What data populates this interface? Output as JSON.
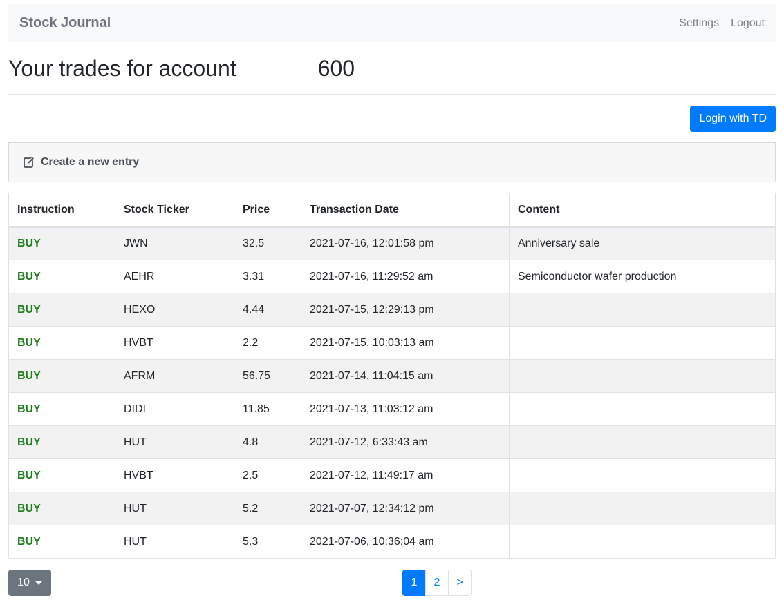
{
  "navbar": {
    "brand": "Stock Journal",
    "links": [
      "Settings",
      "Logout"
    ]
  },
  "header": {
    "title": "Your trades for account",
    "account": "600"
  },
  "actions": {
    "login_label": "Login with TD"
  },
  "create_entry": {
    "icon": "edit-icon",
    "label": "Create a new entry"
  },
  "table": {
    "columns": [
      "Instruction",
      "Stock Ticker",
      "Price",
      "Transaction Date",
      "Content"
    ],
    "rows": [
      {
        "instruction": "BUY",
        "ticker": "JWN",
        "price": "32.5",
        "date": "2021-07-16, 12:01:58 pm",
        "content": "Anniversary sale"
      },
      {
        "instruction": "BUY",
        "ticker": "AEHR",
        "price": "3.31",
        "date": "2021-07-16, 11:29:52 am",
        "content": "Semiconductor wafer production"
      },
      {
        "instruction": "BUY",
        "ticker": "HEXO",
        "price": "4.44",
        "date": "2021-07-15, 12:29:13 pm",
        "content": ""
      },
      {
        "instruction": "BUY",
        "ticker": "HVBT",
        "price": "2.2",
        "date": "2021-07-15, 10:03:13 am",
        "content": ""
      },
      {
        "instruction": "BUY",
        "ticker": "AFRM",
        "price": "56.75",
        "date": "2021-07-14, 11:04:15 am",
        "content": ""
      },
      {
        "instruction": "BUY",
        "ticker": "DIDI",
        "price": "11.85",
        "date": "2021-07-13, 11:03:12 am",
        "content": ""
      },
      {
        "instruction": "BUY",
        "ticker": "HUT",
        "price": "4.8",
        "date": "2021-07-12, 6:33:43 am",
        "content": ""
      },
      {
        "instruction": "BUY",
        "ticker": "HVBT",
        "price": "2.5",
        "date": "2021-07-12, 11:49:17 am",
        "content": ""
      },
      {
        "instruction": "BUY",
        "ticker": "HUT",
        "price": "5.2",
        "date": "2021-07-07, 12:34:12 pm",
        "content": ""
      },
      {
        "instruction": "BUY",
        "ticker": "HUT",
        "price": "5.3",
        "date": "2021-07-06, 10:36:04 am",
        "content": ""
      }
    ]
  },
  "footer": {
    "page_size": "10",
    "pages": [
      "1",
      "2"
    ],
    "next_label": ">",
    "active_page": "1"
  },
  "colors": {
    "primary": "#007bff",
    "buy": "#1e7e1e",
    "secondary": "#6c757d"
  }
}
